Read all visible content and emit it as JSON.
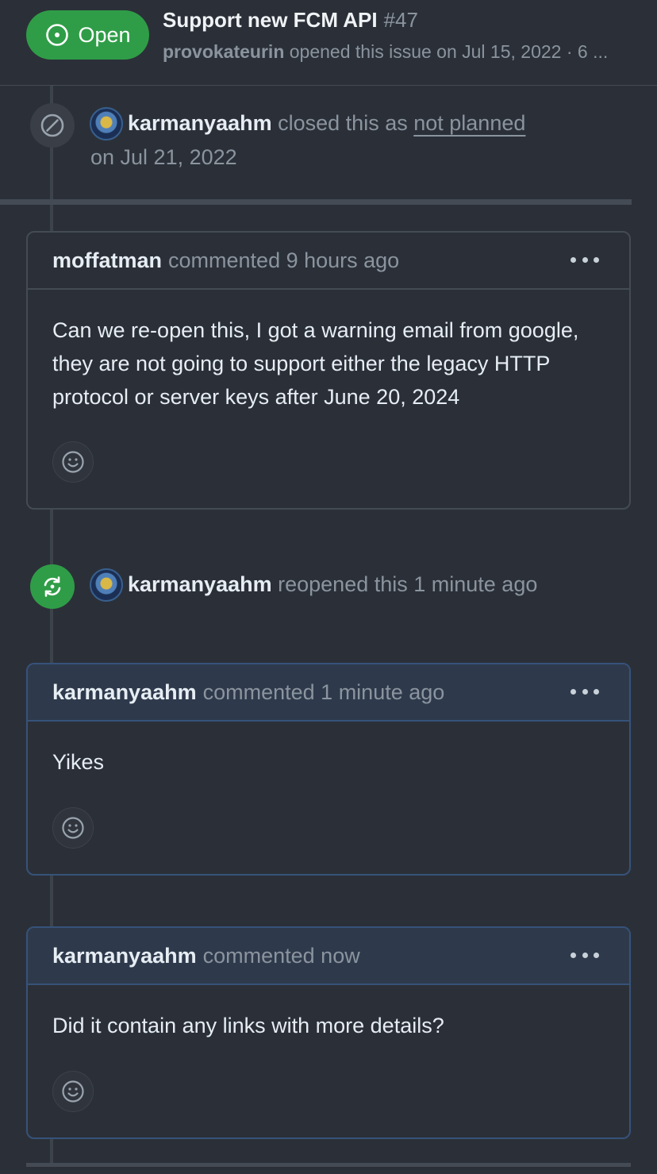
{
  "header": {
    "status_label": "Open",
    "title": "Support new FCM API",
    "number": "#47",
    "author": "provokateurin",
    "meta_text": "opened this issue on Jul 15, 2022 · 6 ..."
  },
  "closed_event": {
    "actor": "karmanyaahm",
    "text_before": "closed this as",
    "reason": "not planned",
    "date": "on Jul 21, 2022"
  },
  "comments": [
    {
      "author": "moffatman",
      "meta": "commented 9 hours ago",
      "body": "Can we re-open this, I got a warning email from google, they are not going to support either the legacy HTTP protocol or server keys after June 20, 2024"
    },
    {
      "author": "karmanyaahm",
      "meta": "commented 1 minute ago",
      "body": "Yikes"
    },
    {
      "author": "karmanyaahm",
      "meta": "commented now",
      "body": "Did it contain any links with more details?"
    }
  ],
  "reopened_event": {
    "actor": "karmanyaahm",
    "text": "reopened this 1 minute ago"
  },
  "colors": {
    "background": "#2b3038",
    "open_green": "#2f9d47",
    "own_comment_header": "#2e3a4c",
    "own_comment_border": "#36527a"
  },
  "icons": {
    "open_badge": "issue-open-icon",
    "closed_event": "skip-circle-icon",
    "reopened_event": "sync-icon",
    "comment_menu": "kebab-horizontal-icon",
    "reaction": "smiley-icon"
  }
}
